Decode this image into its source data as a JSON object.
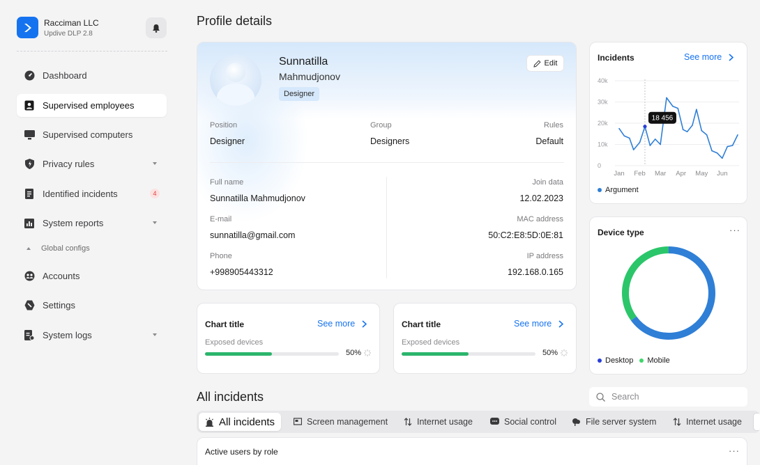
{
  "brand": {
    "name": "Racciman LLC",
    "version": "Updive DLP 2.8"
  },
  "sidebar": {
    "items": [
      {
        "label": "Dashboard"
      },
      {
        "label": "Supervised employees"
      },
      {
        "label": "Supervised computers"
      },
      {
        "label": "Privacy rules"
      },
      {
        "label": "Identified incidents",
        "badge": "4"
      },
      {
        "label": "System reports"
      },
      {
        "label": "Global configs"
      },
      {
        "label": "Accounts"
      },
      {
        "label": "Settings"
      },
      {
        "label": "System logs"
      }
    ],
    "active": "Supervised employees"
  },
  "page": {
    "title": "Profile details"
  },
  "profile": {
    "first_name": "Sunnatilla",
    "last_name": "Mahmudjonov",
    "role_badge": "Designer",
    "edit_label": "Edit",
    "position_label": "Position",
    "position": "Designer",
    "group_label": "Group",
    "group": "Designers",
    "rules_label": "Rules",
    "rules": "Default",
    "fullname_label": "Full name",
    "fullname": "Sunnatilla Mahmudjonov",
    "email_label": "E-mail",
    "email": "sunnatilla@gmail.com",
    "phone_label": "Phone",
    "phone": "+998905443312",
    "join_label": "Join data",
    "join": "12.02.2023",
    "mac_label": "MAC address",
    "mac": "50:C2:E8:5D:0E:81",
    "ip_label": "IP address",
    "ip": "192.168.0.165"
  },
  "cards": [
    {
      "title": "Chart title",
      "see_more": "See more",
      "subtitle": "Exposed devices",
      "percent_label": "50%",
      "progress": 0.5
    },
    {
      "title": "Chart title",
      "see_more": "See more",
      "subtitle": "Exposed devices",
      "percent_label": "50%",
      "progress": 0.5
    }
  ],
  "incidents_card": {
    "title": "Incidents",
    "see_more": "See more",
    "tooltip": "18 456",
    "legend": "Argument"
  },
  "device_card": {
    "title": "Device type",
    "menu": "···",
    "legend_desktop": "Desktop",
    "legend_mobile": "Mobile"
  },
  "all_incidents": {
    "title": "All incidents",
    "search_placeholder": "Search",
    "tabs": [
      "All incidents",
      "Screen management",
      "Internet usage",
      "Social control",
      "File server system",
      "Internet usage"
    ],
    "bottom_card_title": "Active users by role",
    "menu": "···"
  },
  "colors": {
    "accent": "#1673f0",
    "green": "#2bb56c",
    "line": "#2f7fd6",
    "desktop": "#2a3fd6",
    "mobile": "#3fd66a"
  },
  "chart_data": [
    {
      "type": "line",
      "title": "Incidents",
      "x_ticks": [
        "Jan",
        "Feb",
        "Mar",
        "Apr",
        "May",
        "Jun"
      ],
      "y_ticks": [
        "0",
        "10k",
        "20k",
        "30k",
        "40k"
      ],
      "ylim": [
        0,
        40000
      ],
      "series": [
        {
          "name": "Argument",
          "x": [
            0,
            0.25,
            0.5,
            0.7,
            1.0,
            1.25,
            1.5,
            1.75,
            2.0,
            2.3,
            2.6,
            2.85,
            3.1,
            3.3,
            3.55,
            3.75,
            4.0,
            4.25,
            4.5,
            4.75,
            5.0
          ],
          "values": [
            17500,
            14000,
            13000,
            7500,
            11000,
            18456,
            9500,
            12500,
            10000,
            32000,
            28000,
            27000,
            17000,
            16000,
            19000,
            26500,
            16500,
            14500,
            7000,
            6000,
            3500
          ]
        }
      ],
      "x_extra": [
        [
          5.25,
          9000
        ],
        [
          5.5,
          9500
        ],
        [
          5.75,
          14500
        ]
      ],
      "highlight": {
        "label": "18 456",
        "x": 1.25,
        "y": 18456
      },
      "legend": [
        "Argument"
      ]
    },
    {
      "type": "pie",
      "title": "Device type",
      "labels": [
        "Desktop",
        "Mobile"
      ],
      "values": [
        65,
        35
      ],
      "legend": [
        "Desktop",
        "Mobile"
      ]
    }
  ]
}
